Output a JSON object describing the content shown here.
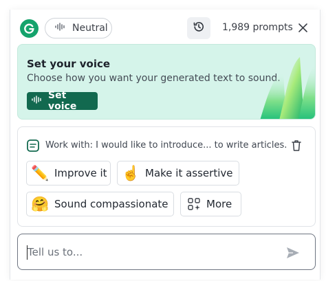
{
  "header": {
    "tone_label": "Neutral",
    "prompts_count": "1,989 prompts"
  },
  "voice_card": {
    "title": "Set your voice",
    "subtitle": "Choose how you want your generated text to sound.",
    "button_label": "Set voice"
  },
  "work_card": {
    "context_text": "Work with: I would like to introduce... to write articles.",
    "suggestions": [
      {
        "label": "Improve it",
        "icon": "pencil-emoji",
        "emoji": "✏️"
      },
      {
        "label": "Make it assertive",
        "icon": "pointing-hand-emoji",
        "emoji": "☝️"
      },
      {
        "label": "Sound compassionate",
        "icon": "hugging-face-emoji",
        "emoji": "🤗"
      },
      {
        "label": "More",
        "icon": "grid-sparkle-icon"
      }
    ]
  },
  "prompt_input": {
    "placeholder": "Tell us to..."
  },
  "colors": {
    "brand": "#15a36c",
    "button": "#12694f",
    "card_bg": "#d5f4ea"
  }
}
